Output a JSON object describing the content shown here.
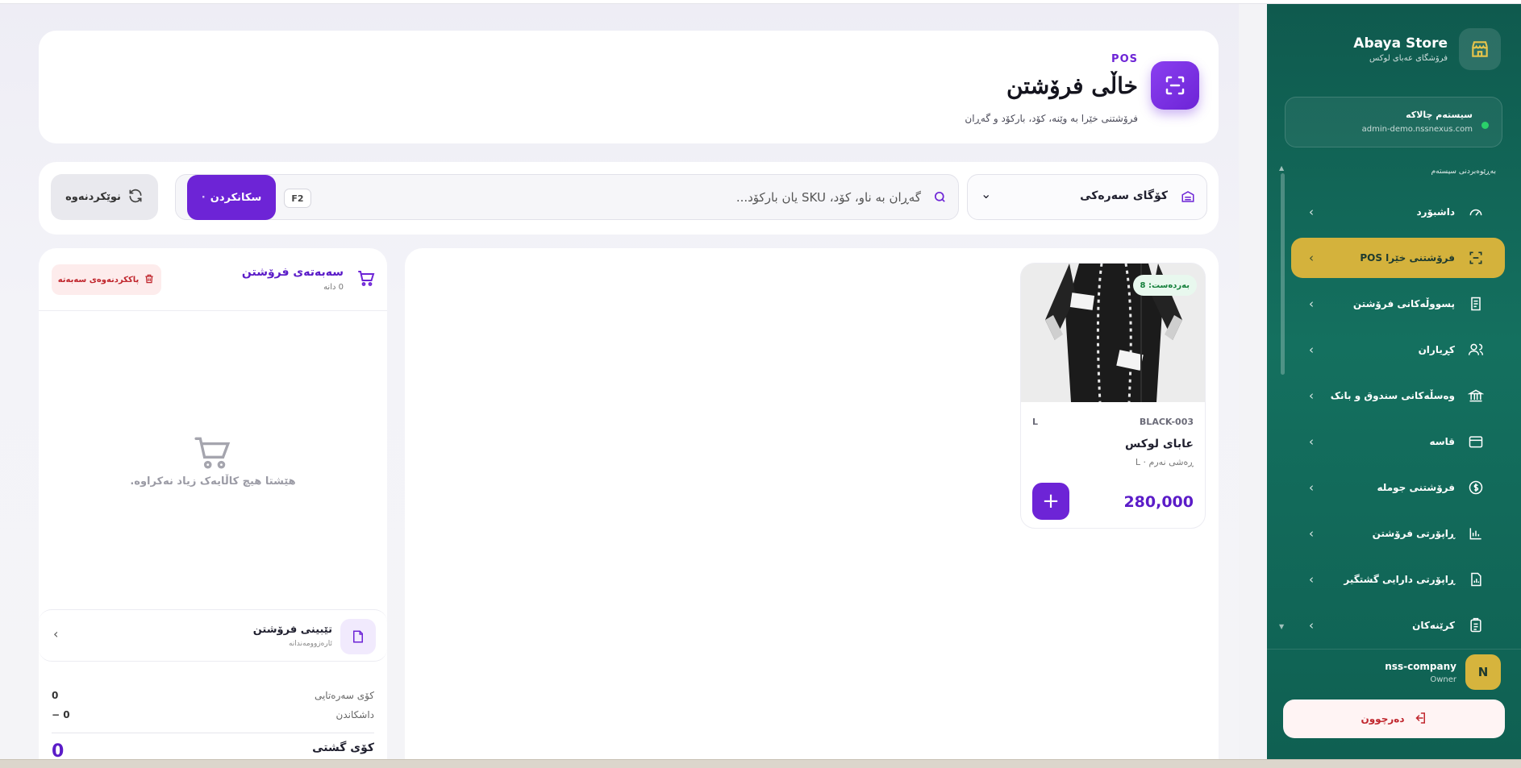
{
  "brand": {
    "name": "Abaya Store",
    "subtitle": "فرۆشگای عەبای لوکس"
  },
  "system": {
    "title": "سیستەم چالاکە",
    "host": "admin-demo.nssnexus.com"
  },
  "nav": {
    "section_title": "بەڕێوەبردنی سیستەم",
    "items": [
      {
        "label": "داشبۆرد",
        "icon": "gauge-icon"
      },
      {
        "label": "فرۆشتنی خێرا POS",
        "icon": "scan-icon",
        "active": true
      },
      {
        "label": "پسووڵەکانی فرۆشتن",
        "icon": "receipt-icon"
      },
      {
        "label": "کڕیاران",
        "icon": "users-icon"
      },
      {
        "label": "وەسڵەکانی سندوق و بانک",
        "icon": "bank-icon"
      },
      {
        "label": "قاسە",
        "icon": "cashbox-icon"
      },
      {
        "label": "فرۆشتنی جوملە",
        "icon": "dollar-icon"
      },
      {
        "label": "ڕاپۆرتی فرۆشتن",
        "icon": "chart-icon"
      },
      {
        "label": "ڕاپۆرتی دارایی گشتگیر",
        "icon": "report-icon"
      },
      {
        "label": "کرێنەکان",
        "icon": "clipboard-icon"
      }
    ]
  },
  "user": {
    "initial": "N",
    "name": "nss-company",
    "role": "Owner"
  },
  "logout_label": "دەرچوون",
  "header": {
    "tag": "POS",
    "title": "خاڵی فرۆشتن",
    "subtitle": "فرۆشتنی خێرا بە وێنە، کۆد، بارکۆد و گەڕان"
  },
  "toolbar": {
    "store_label": "کۆگای سەرەکی",
    "search_placeholder": "گەڕان بە ناو، کۆد، SKU یان بارکۆد...",
    "shortcut": "F2",
    "scan_label": "سکانکردن",
    "scan_dot": "·",
    "refresh_label": "نوێکردنەوە"
  },
  "product": {
    "stock_badge": "بەردەست: 8",
    "sku": "BLACK-003",
    "size": "L",
    "name": "عابای لوکس",
    "variant": "ڕەشی نەرم · L",
    "price": "280,000",
    "add_symbol": "+"
  },
  "cart": {
    "title": "سەبەتەی فرۆشتن",
    "count": "0 دانە",
    "clear_label": "پاککردنەوەی سەبەتە",
    "empty_text": "هێشتا هیچ کاڵایەک زیاد نەکراوە.",
    "note_title": "تێبینی فرۆشتن",
    "note_sub": "ئارەزوومەندانە",
    "subtotal_label": "کۆی سەرەتایی",
    "subtotal_value": "0",
    "discount_label": "داشکاندن",
    "discount_value": "− 0",
    "total_label": "کۆی گشتی",
    "total_value": "0"
  }
}
